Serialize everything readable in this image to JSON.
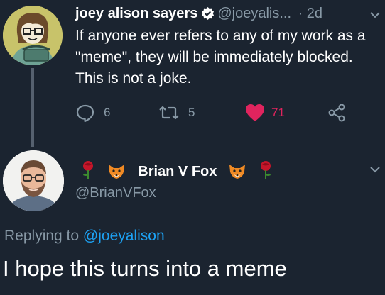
{
  "tweet": {
    "author_name": "joey alison sayers",
    "author_handle": "@joeyalis...",
    "separator": "·",
    "time": "2d",
    "text": "If anyone ever refers to any of my work as a \"meme\", they will be immediately blocked. This is not a joke.",
    "reply_count": "6",
    "retweet_count": "5",
    "like_count": "71"
  },
  "reply": {
    "author_name": "Brian V Fox",
    "author_handle": "@BrianVFox",
    "replying_prefix": "Replying to",
    "replying_handle": "@joeyalison",
    "text": "I hope this turns into a meme"
  },
  "colors": {
    "background": "#1b2430",
    "secondary_text": "#8899a6",
    "link": "#1da1f2",
    "like": "#e0245e",
    "thread_line": "#56616f"
  },
  "icons": {
    "reply": "reply-icon",
    "retweet": "retweet-icon",
    "like": "heart-icon",
    "share": "share-icon",
    "verified": "verified-badge-icon",
    "menu": "chevron-down-icon",
    "rose": "rose-emoji-icon",
    "fox": "fox-emoji-icon"
  }
}
